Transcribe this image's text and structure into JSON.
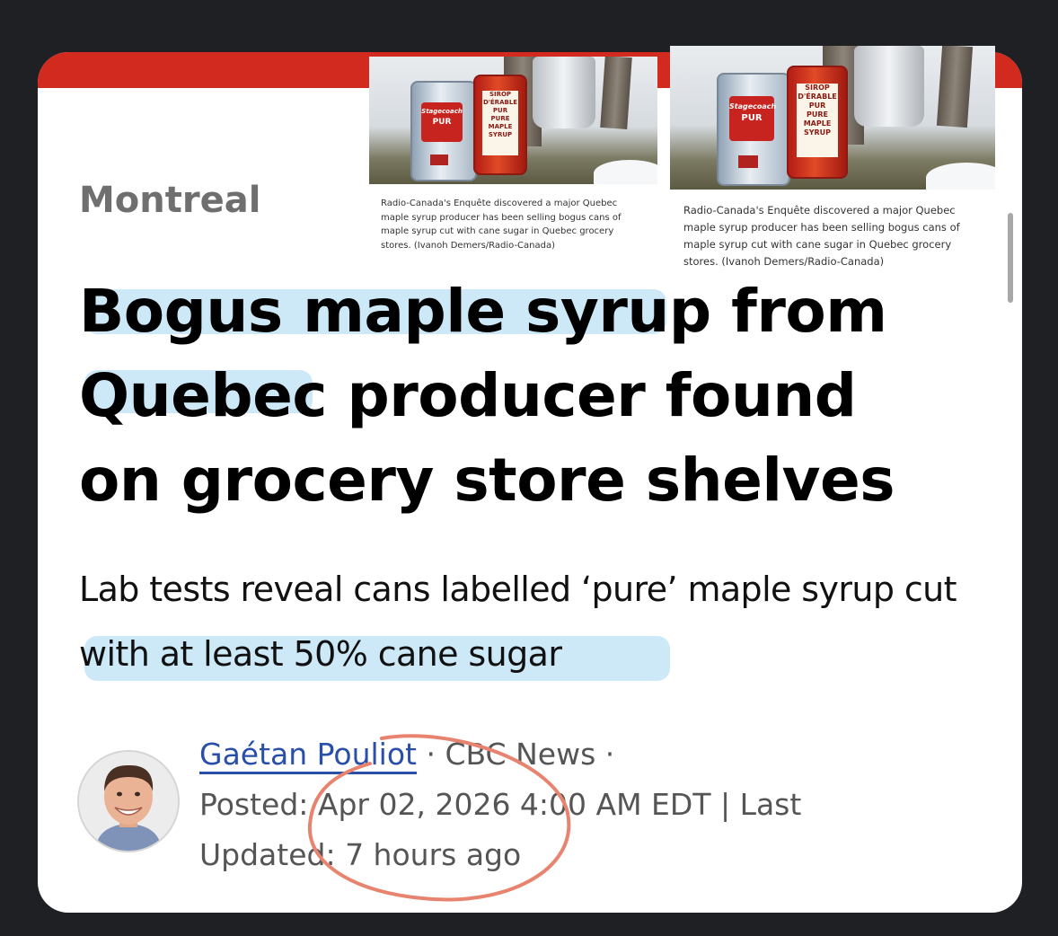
{
  "section_label": "Montreal",
  "photos": [
    {
      "caption": "Radio-Canada's Enquête discovered a major Quebec maple syrup producer has been selling bogus cans of maple syrup cut with cane sugar in Quebec grocery stores. (Ivanoh Demers/Radio-Canada)"
    },
    {
      "caption": "Radio-Canada's Enquête discovered a major Quebec maple syrup producer has been selling bogus cans of maple syrup cut with cane sugar in Quebec grocery stores. (Ivanoh Demers/Radio-Canada)"
    }
  ],
  "can_labels": {
    "can1_brand": "Stagecoach",
    "can1_word": "PUR",
    "can2_line1": "SIROP",
    "can2_line2": "D'ÉRABLE",
    "can2_line3": "PUR",
    "can2_line4": "PURE",
    "can2_line5": "MAPLE",
    "can2_line6": "SYRUP"
  },
  "headline": {
    "hl1": "Bogus maple syrup",
    "rest1": " from",
    "hl2": "Quebec",
    "rest2": " producer found on grocery store shelves"
  },
  "dek": {
    "part1": "Lab tests reveal cans labelled ‘pure’ maple syrup ",
    "hl": "cut with at least 50% cane sugar"
  },
  "byline": {
    "author": "Gaétan Pouliot",
    "sep1": " · ",
    "outlet": "CBC News",
    "sep2": " · ",
    "posted": "Posted: Apr 02, 2026 4:00 AM EDT | Last Updated: 7 hours ago"
  },
  "colors": {
    "brand_red": "#d32a1f",
    "highlight": "#cde9f8",
    "author_link": "#2a4fa8",
    "annotation_circle": "#e8836f"
  }
}
